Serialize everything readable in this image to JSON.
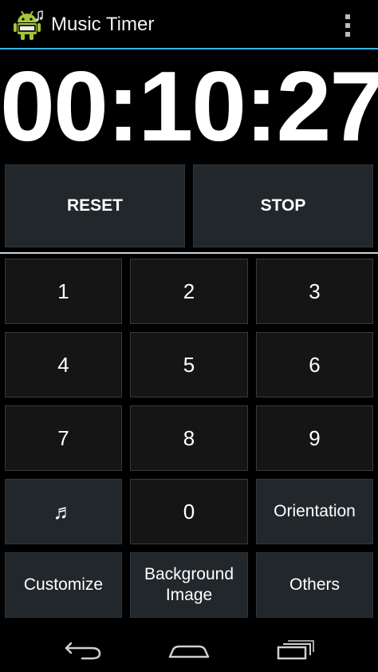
{
  "app": {
    "title": "Music Timer",
    "icon": "android-app-icon",
    "menu_icon": "overflow-menu-icon"
  },
  "timer": {
    "display": "00:10:27"
  },
  "controls": {
    "reset_label": "RESET",
    "stop_label": "STOP"
  },
  "keypad": {
    "k1": "1",
    "k2": "2",
    "k3": "3",
    "k4": "4",
    "k5": "5",
    "k6": "6",
    "k7": "7",
    "k8": "8",
    "k9": "9",
    "music": "♬",
    "k0": "0",
    "orientation": "Orientation",
    "customize": "Customize",
    "background_line1": "Background",
    "background_line2": "Image",
    "others": "Others"
  },
  "navbar": {
    "back_icon": "back-icon",
    "home_icon": "home-icon",
    "recents_icon": "recents-icon"
  },
  "colors": {
    "accent": "#33b5e5",
    "button": "#22272b",
    "key": "#151515",
    "background": "#000000"
  }
}
